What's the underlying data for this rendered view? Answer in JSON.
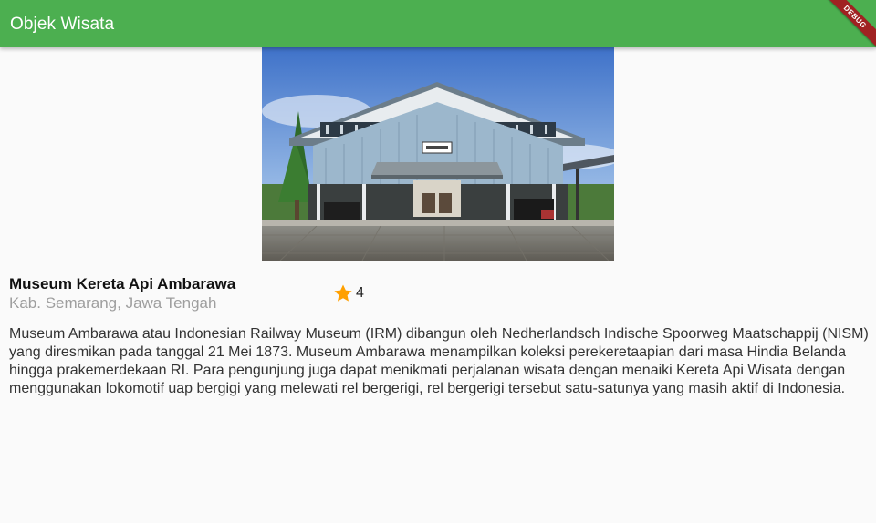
{
  "app_bar": {
    "title": "Objek Wisata",
    "debug_label": "DEBUG"
  },
  "place": {
    "image_icon": "museum-photo",
    "name": "Museum Kereta Api Ambarawa",
    "location": "Kab. Semarang, Jawa Tengah",
    "rating": "4",
    "rating_icon": "star-icon",
    "description": "Museum Ambarawa atau Indonesian Railway Museum (IRM) dibangun oleh Nedherlandsch Indische Spoorweg Maatschappij (NISM) yang diresmikan pada tanggal 21 Mei 1873. Museum Ambarawa menampilkan koleksi perekeretaapian dari masa Hindia Belanda hingga prakemerdekaan RI. Para pengunjung juga dapat menikmati perjalanan wisata dengan menaiki Kereta Api Wisata dengan menggunakan lokomotif uap bergigi yang melewati rel bergerigi, rel bergerigi tersebut satu-satunya yang masih aktif di Indonesia."
  },
  "colors": {
    "app_bar": "#4caf50",
    "star": "#ffa000",
    "location_text": "#9e9e9e",
    "debug_ribbon": "#a02222"
  }
}
